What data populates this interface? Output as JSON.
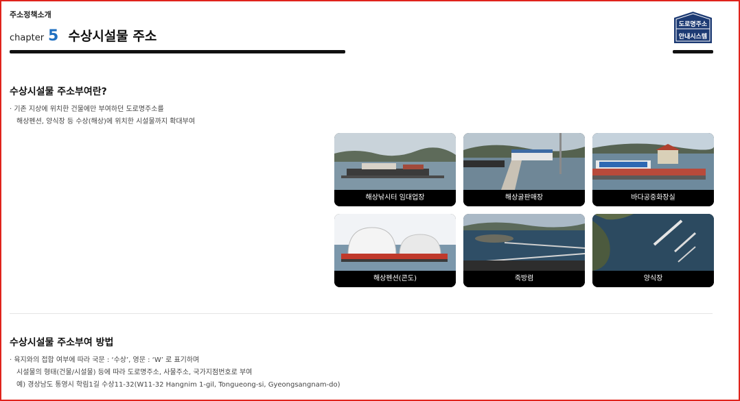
{
  "header": {
    "category": "주소정책소개",
    "chapter_word": "chapter",
    "chapter_number": "5",
    "title": "수상시설물 주소"
  },
  "logo": {
    "line1": "도로명주소",
    "line2": "안내시스템",
    "color": "#1c3a73"
  },
  "section1": {
    "heading": "수상시설물 주소부여란?",
    "lines": [
      "· 기존 지상에 위치한 건물에만 부여하던 도로명주소를",
      "해상펜션, 양식장 등 수상(해상)에 위치한 시설물까지 확대부여"
    ]
  },
  "photos": [
    {
      "caption": "해상낚시터 임대업장",
      "icon": "fishing-platform-photo"
    },
    {
      "caption": "해상굴판매장",
      "icon": "oyster-market-photo"
    },
    {
      "caption": "바다공중화장실",
      "icon": "sea-toilet-photo"
    },
    {
      "caption": "해상펜션(콘도)",
      "icon": "sea-pension-photo"
    },
    {
      "caption": "죽방렴",
      "icon": "bamboo-weir-photo"
    },
    {
      "caption": "양식장",
      "icon": "fish-farm-photo"
    }
  ],
  "section2": {
    "heading": "수상시설물 주소부여 방법",
    "lines": [
      "· 육지와의 접합 여부에 따라 국문 : ‘수상’, 영문 : ‘W’ 로 표기하며",
      "시설물의 형태(건물/시설물) 등에 따라 도로명주소, 사물주소, 국가지점번호로 부여",
      "예) 경상남도 통영시 학림1길 수상11-32(W11-32 Hangnim 1-gil, Tongueong-si, Gyeongsangnam-do)"
    ]
  },
  "colors": {
    "accent_blue": "#1f6fc1",
    "frame_red": "#e0231c"
  }
}
